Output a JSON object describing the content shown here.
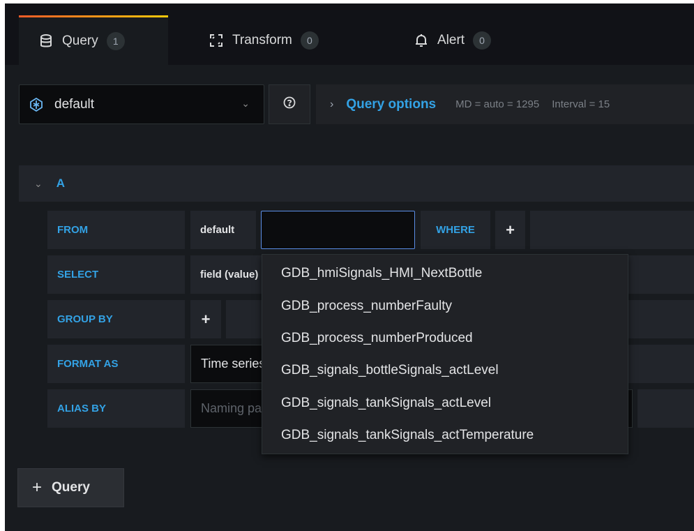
{
  "tabs": [
    {
      "label": "Query",
      "count": "1",
      "icon": "database-icon",
      "active": true
    },
    {
      "label": "Transform",
      "count": "0",
      "icon": "transform-icon",
      "active": false
    },
    {
      "label": "Alert",
      "count": "0",
      "icon": "bell-icon",
      "active": false
    }
  ],
  "datasource": {
    "name": "default",
    "icon": "influxdb-icon"
  },
  "query_options": {
    "title": "Query options",
    "md": "MD = auto = 1295",
    "interval": "Interval = 15"
  },
  "query": {
    "ref_id": "A",
    "rows": {
      "from": {
        "label": "FROM",
        "policy": "default",
        "measurement_value": "",
        "where_label": "WHERE"
      },
      "select": {
        "label": "SELECT",
        "field": "field (value)"
      },
      "group_by": {
        "label": "GROUP BY"
      },
      "format_as": {
        "label": "FORMAT AS",
        "value": "Time series"
      },
      "alias_by": {
        "label": "ALIAS BY",
        "placeholder": "Naming pattern"
      }
    }
  },
  "measurements_dropdown": [
    "GDB_hmiSignals_HMI_NextBottle",
    "GDB_process_numberFaulty",
    "GDB_process_numberProduced",
    "GDB_signals_bottleSignals_actLevel",
    "GDB_signals_tankSignals_actLevel",
    "GDB_signals_tankSignals_actTemperature"
  ],
  "add_query": {
    "label": "Query"
  },
  "colors": {
    "accent": "#33a2e5",
    "focus_border": "#5b8ee6",
    "background": "#111217"
  }
}
